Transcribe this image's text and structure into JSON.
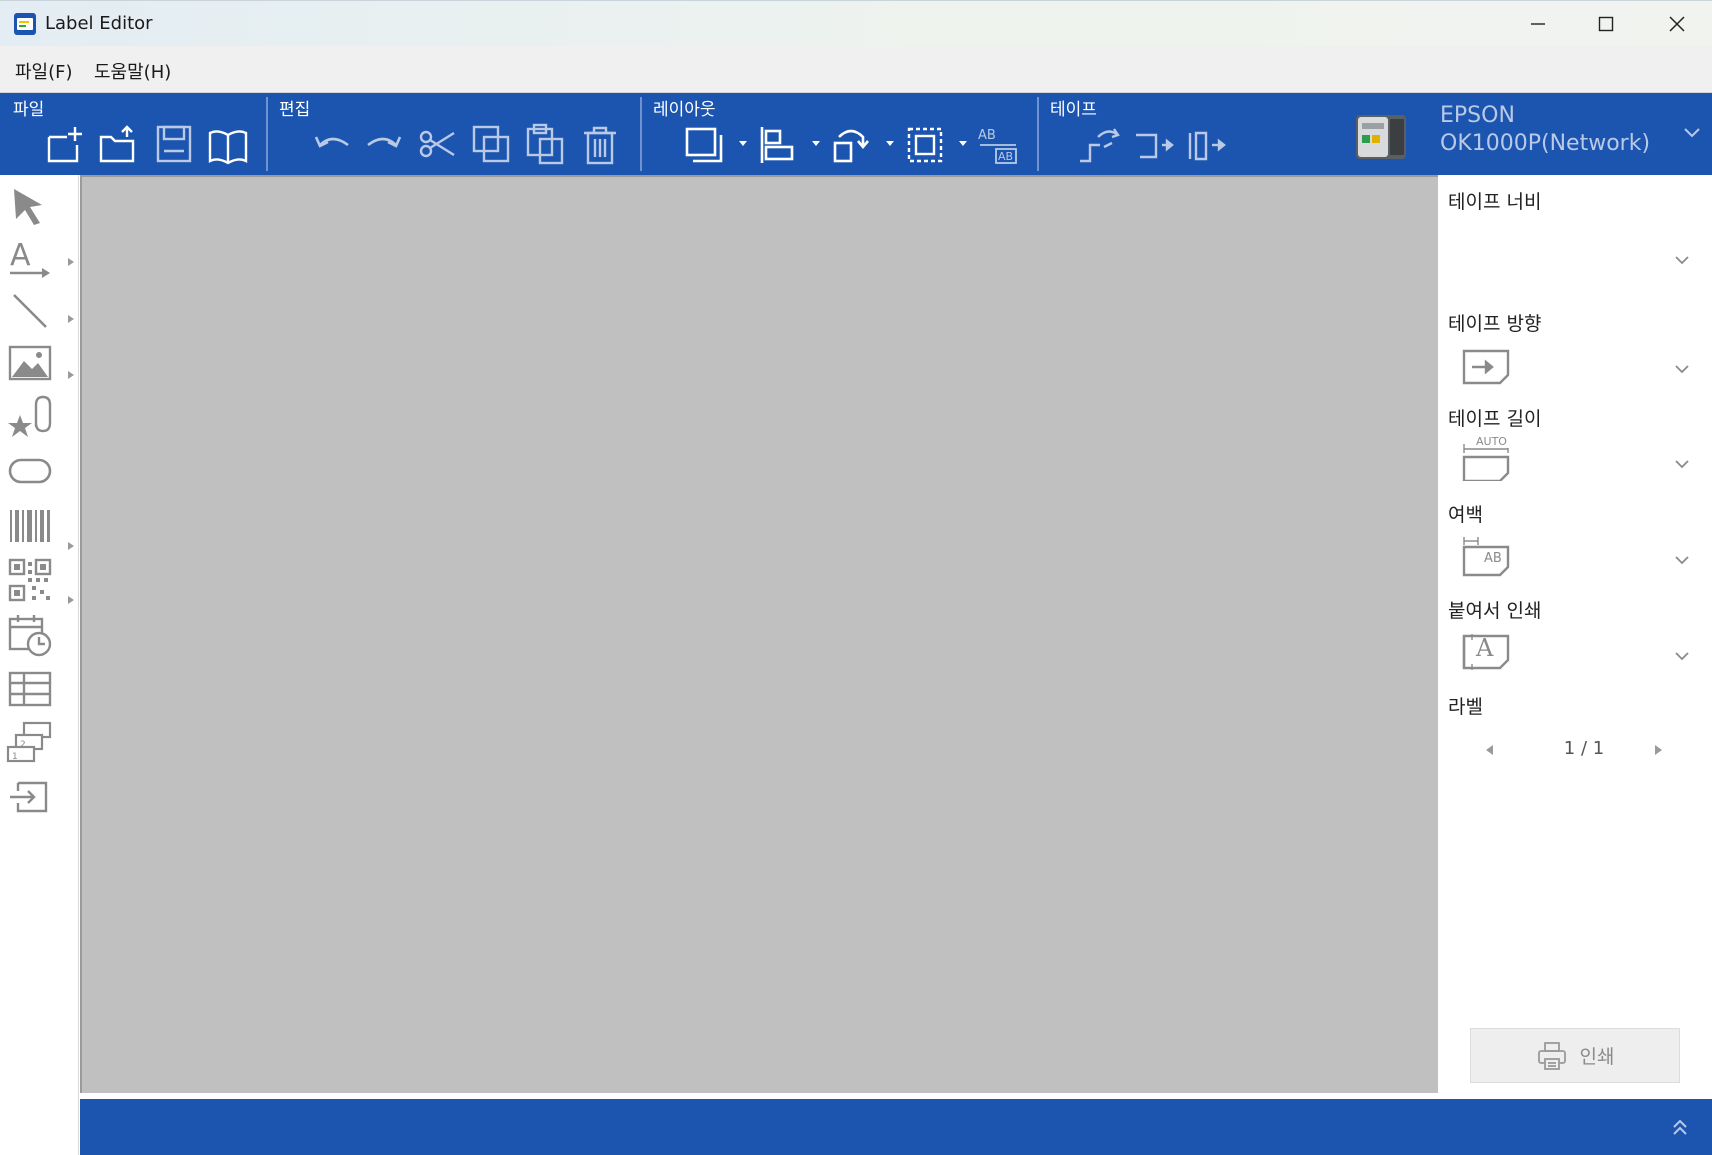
{
  "window": {
    "title": "Label Editor",
    "controls": [
      "minimize",
      "maximize",
      "close"
    ]
  },
  "menu": {
    "items": [
      {
        "label": "파일(F)"
      },
      {
        "label": "도움말(H)"
      }
    ]
  },
  "ribbon": {
    "groups": [
      {
        "label": "파일",
        "icons": [
          "new-label-icon",
          "open-folder-icon",
          "save-icon",
          "catalog-book-icon"
        ]
      },
      {
        "label": "편집",
        "icons": [
          "undo-icon",
          "redo-icon",
          "cut-icon",
          "copy-icon",
          "paste-icon",
          "delete-icon"
        ]
      },
      {
        "label": "레이아웃",
        "icons": [
          "frame-icon",
          "align-icon",
          "rotate-icon",
          "fit-icon",
          "text-fit-icon"
        ]
      },
      {
        "label": "테이프",
        "icons": [
          "tape-feed-icon",
          "tape-cut-icon",
          "half-cut-icon"
        ]
      }
    ],
    "printer": {
      "line1": "EPSON",
      "line2": "OK1000P(Network)"
    }
  },
  "tools": [
    "select-pointer-icon",
    "text-tool-icon",
    "line-tool-icon",
    "image-tool-icon",
    "clipart-tool-icon",
    "shape-tool-icon",
    "barcode-tool-icon",
    "qrcode-tool-icon",
    "date-time-tool-icon",
    "table-tool-icon",
    "serial-number-tool-icon",
    "import-tool-icon"
  ],
  "panel": {
    "tape_width": {
      "label": "테이프 너비"
    },
    "tape_direction": {
      "label": "테이프 방향"
    },
    "tape_length": {
      "label": "테이프 길이",
      "icon_text": "AUTO"
    },
    "margin": {
      "label": "여백",
      "icon_text": "AB"
    },
    "continuous_print": {
      "label": "붙여서 인쇄",
      "icon_text": "A"
    },
    "label": {
      "label": "라벨",
      "page_indicator": "1 / 1"
    },
    "print_button": "인쇄"
  },
  "colors": {
    "ribbon": "#1c55b0",
    "canvas": "#c0c0c0",
    "icon_muted": "#b9c9e6",
    "toolbox_icon": "#8a8a8a"
  }
}
